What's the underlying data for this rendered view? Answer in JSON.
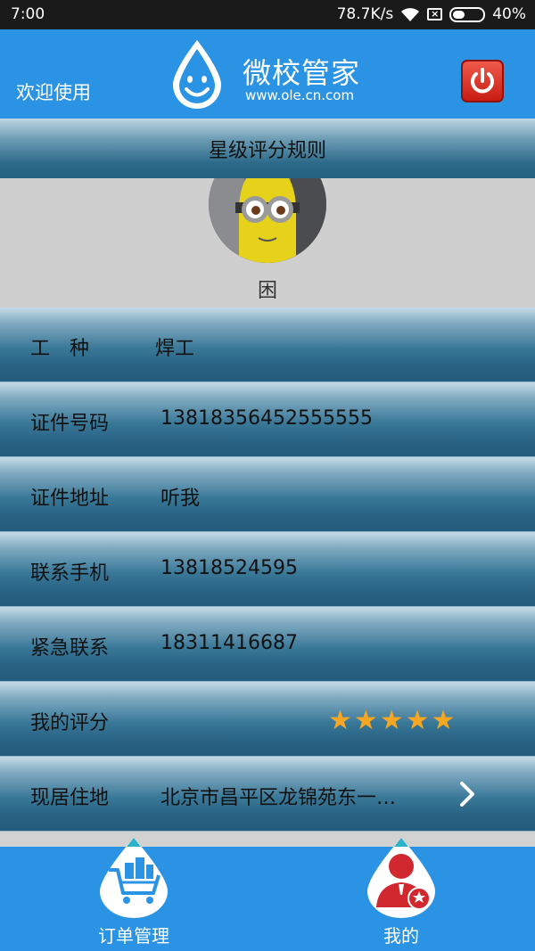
{
  "status_bar": {
    "time": "7:00",
    "network_speed": "78.7K/s",
    "battery": "40%",
    "battery_level": 0.4,
    "icons": [
      "wifi-icon",
      "no-sim-icon",
      "battery-icon"
    ]
  },
  "header": {
    "welcome": "欢迎使用",
    "brand_name": "微校管家",
    "brand_url": "www.ole.cn.com",
    "power_icon": "power-icon"
  },
  "section_title": "星级评分规则",
  "profile": {
    "status": "困"
  },
  "rows": {
    "trade": {
      "label": "工　种",
      "value": "焊工"
    },
    "id_number": {
      "label": "证件号码",
      "value": "13818356452555555"
    },
    "id_address": {
      "label": "证件地址",
      "value": "听我"
    },
    "phone": {
      "label": "联系手机",
      "value": "13818524595"
    },
    "emergency": {
      "label": "紧急联系",
      "value": "18311416687"
    },
    "rating": {
      "label": "我的评分",
      "stars": "★★★★★",
      "value": 5,
      "max": 5
    },
    "residence": {
      "label": "现居住地",
      "value": "北京市昌平区龙锦苑东一…"
    }
  },
  "bottom_nav": {
    "orders": "订单管理",
    "mine": "我的"
  },
  "colors": {
    "primary_blue": "#2b93e3",
    "row_blue": "#276283",
    "star": "#f5a623",
    "power_red": "#d9281b"
  }
}
